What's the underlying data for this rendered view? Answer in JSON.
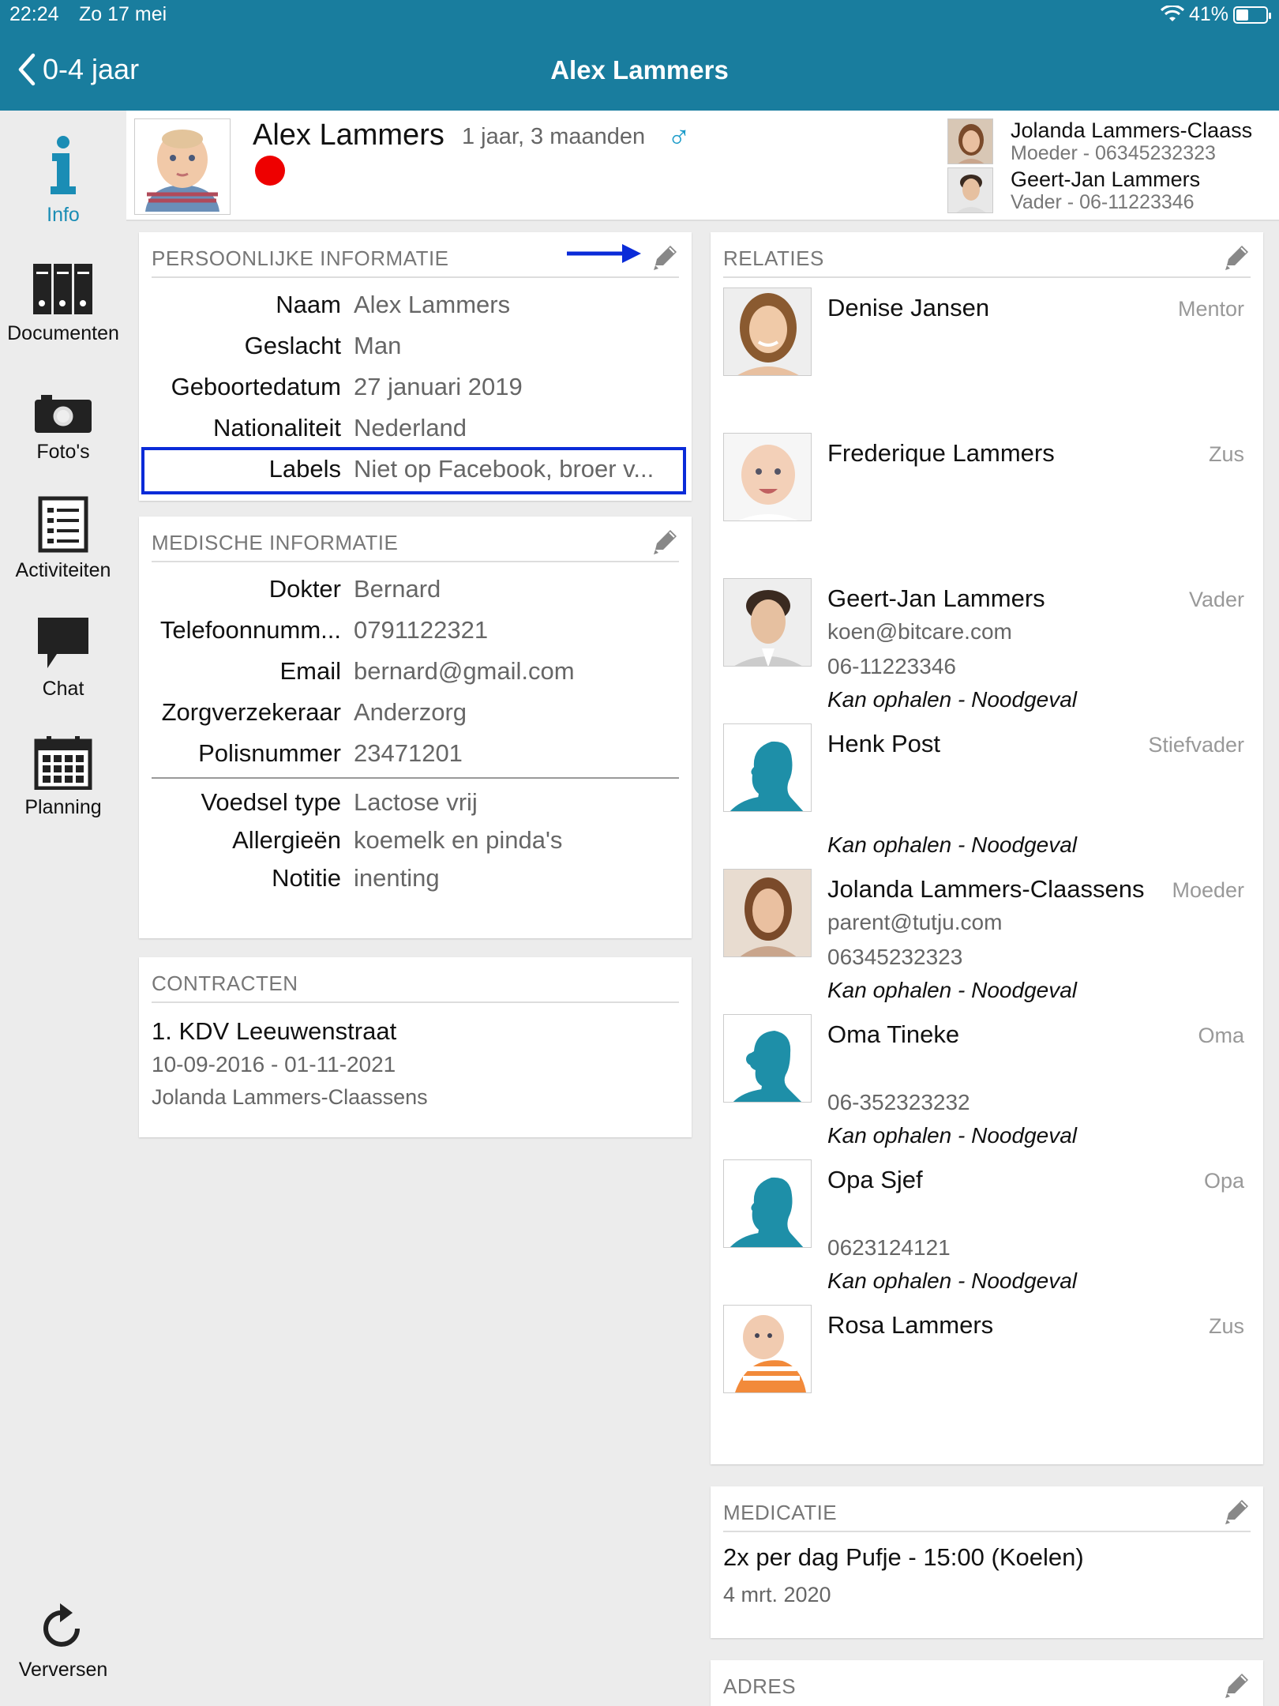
{
  "status": {
    "time": "22:24",
    "date": "Zo 17 mei",
    "battery": "41%",
    "battery_level": 0.41
  },
  "nav": {
    "back_label": "0-4 jaar",
    "title": "Alex Lammers"
  },
  "sidebar": {
    "items": [
      {
        "label": "Info",
        "icon": "info-icon",
        "active": true
      },
      {
        "label": "Documenten",
        "icon": "documents-icon"
      },
      {
        "label": "Foto's",
        "icon": "camera-icon"
      },
      {
        "label": "Activiteiten",
        "icon": "activities-icon"
      },
      {
        "label": "Chat",
        "icon": "chat-icon"
      },
      {
        "label": "Planning",
        "icon": "calendar-icon"
      }
    ],
    "refresh_label": "Verversen"
  },
  "header": {
    "child_name": "Alex Lammers",
    "age": "1 jaar, 3 maanden",
    "gender_symbol": "♂",
    "parents": [
      {
        "name": "Jolanda Lammers-Claass",
        "sub": "Moeder - 06345232323"
      },
      {
        "name": "Geert-Jan Lammers",
        "sub": "Vader - 06-11223346"
      }
    ]
  },
  "personal": {
    "title": "PERSOONLIJKE INFORMATIE",
    "rows": [
      {
        "label": "Naam",
        "value": "Alex Lammers"
      },
      {
        "label": "Geslacht",
        "value": "Man"
      },
      {
        "label": "Geboortedatum",
        "value": "27 januari 2019"
      },
      {
        "label": "Nationaliteit",
        "value": "Nederland"
      },
      {
        "label": "Labels",
        "value": "Niet op Facebook, broer v..."
      }
    ]
  },
  "medical": {
    "title": "MEDISCHE INFORMATIE",
    "rows": [
      {
        "label": "Dokter",
        "value": "Bernard"
      },
      {
        "label": "Telefoonnumm...",
        "value": "0791122321"
      },
      {
        "label": "Email",
        "value": "bernard@gmail.com"
      },
      {
        "label": "Zorgverzekeraar",
        "value": "Anderzorg"
      },
      {
        "label": "Polisnummer",
        "value": "23471201"
      }
    ],
    "rows2": [
      {
        "label": "Voedsel type",
        "value": "Lactose vrij"
      },
      {
        "label": "Allergieën",
        "value": "koemelk en pinda's"
      },
      {
        "label": "Notitie",
        "value": "inenting"
      }
    ]
  },
  "contracts": {
    "title": "CONTRACTEN",
    "name": "1. KDV Leeuwenstraat",
    "period": "10-09-2016 - 01-11-2021",
    "person": "Jolanda Lammers-Claassens"
  },
  "relations": {
    "title": "RELATIES",
    "items": [
      {
        "name": "Denise Jansen",
        "role": "Mentor",
        "email": "",
        "phone": "",
        "note": "",
        "photo": "woman"
      },
      {
        "name": "Frederique Lammers",
        "role": "Zus",
        "email": "",
        "phone": "",
        "note": "",
        "photo": "baby"
      },
      {
        "name": "Geert-Jan Lammers",
        "role": "Vader",
        "email": "koen@bitcare.com",
        "phone": "06-11223346",
        "note": "Kan ophalen - Noodgeval",
        "photo": "man"
      },
      {
        "name": "Henk Post",
        "role": "Stiefvader",
        "email": "",
        "phone": "",
        "note": "Kan ophalen - Noodgeval",
        "photo": "silhouette-male"
      },
      {
        "name": "Jolanda Lammers-Claassens",
        "role": "Moeder",
        "email": "parent@tutju.com",
        "phone": "06345232323",
        "note": "Kan ophalen - Noodgeval",
        "photo": "woman2"
      },
      {
        "name": "Oma Tineke",
        "role": "Oma",
        "email": "",
        "phone": "06-352323232",
        "note": "Kan ophalen - Noodgeval",
        "photo": "silhouette-female"
      },
      {
        "name": "Opa Sjef",
        "role": "Opa",
        "email": "",
        "phone": "0623124121",
        "note": "Kan ophalen - Noodgeval",
        "photo": "silhouette-male"
      },
      {
        "name": "Rosa Lammers",
        "role": "Zus",
        "email": "",
        "phone": "",
        "note": "",
        "photo": "baby2"
      }
    ]
  },
  "medication": {
    "title": "MEDICATIE",
    "item": "2x per dag Pufje - 15:00 (Koelen)",
    "date": "4 mrt. 2020"
  },
  "address": {
    "title": "ADRES"
  },
  "colors": {
    "accent": "#197d9e",
    "icon_blue": "#1a8db5",
    "silhouette": "#1e8fa8",
    "highlight": "#0a2bd8",
    "red_dot": "#ee0000"
  }
}
